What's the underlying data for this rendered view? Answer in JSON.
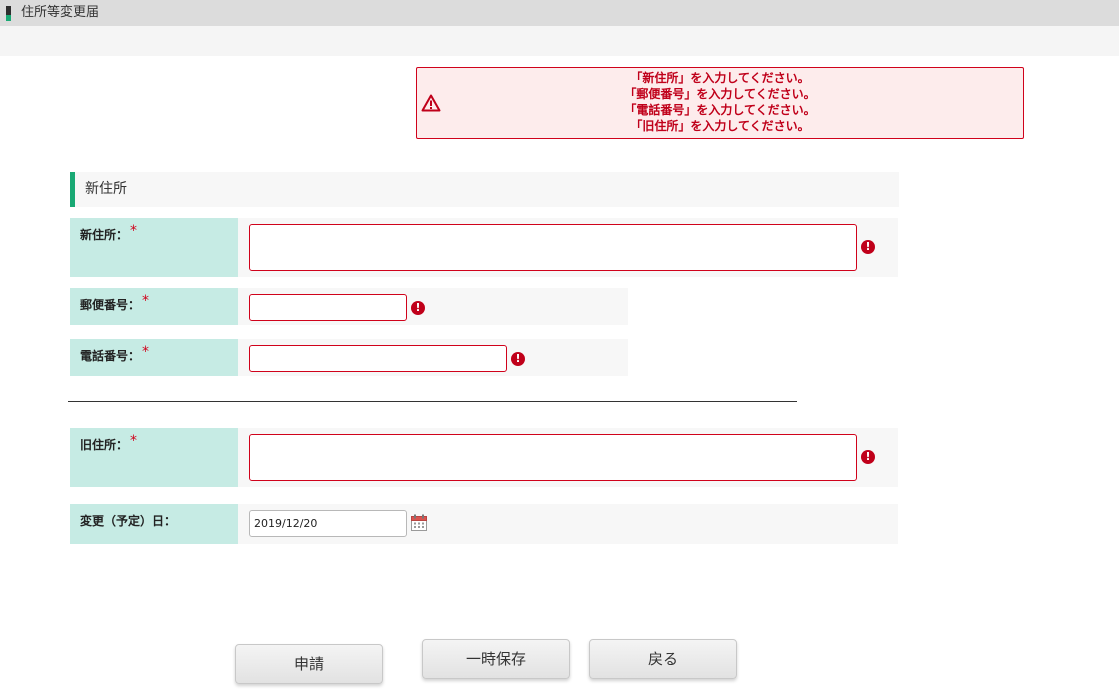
{
  "window": {
    "title": "住所等変更届"
  },
  "errors": [
    "「新住所」を入力してください。",
    "「郵便番号」を入力してください。",
    "「電話番号」を入力してください。",
    "「旧住所」を入力してください。"
  ],
  "section": {
    "title": "新住所"
  },
  "fields": {
    "new_address": {
      "label": "新住所：",
      "required_mark": "*",
      "value": ""
    },
    "postal_code": {
      "label": "郵便番号：",
      "required_mark": "*",
      "value": ""
    },
    "phone": {
      "label": "電話番号：",
      "required_mark": "*",
      "value": ""
    },
    "old_address": {
      "label": "旧住所：",
      "required_mark": "*",
      "value": ""
    },
    "change_date": {
      "label": "変更（予定）日：",
      "value": "2019/12/20"
    }
  },
  "field_error_glyph": "!",
  "buttons": {
    "apply": "申請",
    "save_draft": "一時保存",
    "back": "戻る"
  },
  "colors": {
    "accent": "#19a974",
    "label_bg": "#c6ebe4",
    "error": "#d0021b",
    "error_bg": "#fdecec"
  },
  "icons": {
    "error_banner": "warning-triangle-icon",
    "field_error": "exclamation-circle-icon",
    "date_picker": "calendar-icon"
  }
}
